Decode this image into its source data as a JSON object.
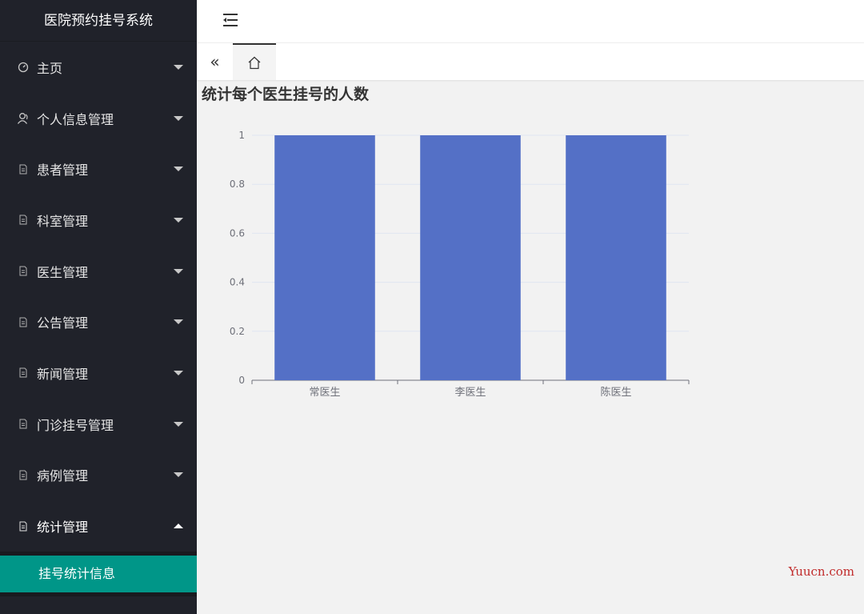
{
  "sidebar": {
    "title": "医院预约挂号系统",
    "items": [
      {
        "label": "主页",
        "icon": "dashboard-icon"
      },
      {
        "label": "个人信息管理",
        "icon": "user-icon"
      },
      {
        "label": "患者管理",
        "icon": "file-icon"
      },
      {
        "label": "科室管理",
        "icon": "file-icon"
      },
      {
        "label": "医生管理",
        "icon": "file-icon"
      },
      {
        "label": "公告管理",
        "icon": "file-icon"
      },
      {
        "label": "新闻管理",
        "icon": "file-icon"
      },
      {
        "label": "门诊挂号管理",
        "icon": "file-icon"
      },
      {
        "label": "病例管理",
        "icon": "file-icon"
      },
      {
        "label": "统计管理",
        "icon": "file-icon",
        "expanded": true
      }
    ],
    "submenu": [
      {
        "label": "挂号统计信息",
        "active": true
      }
    ]
  },
  "colors": {
    "sidebar_bg": "#20222a",
    "active_bg": "#009688",
    "bar_color": "#5470c6"
  },
  "content": {
    "title": "统计每个医生挂号的人数"
  },
  "watermark": "Yuucn.com",
  "chart_data": {
    "type": "bar",
    "title": "统计每个医生挂号的人数",
    "categories": [
      "常医生",
      "李医生",
      "陈医生"
    ],
    "values": [
      1,
      1,
      1
    ],
    "xlabel": "",
    "ylabel": "",
    "ylim": [
      0,
      1
    ],
    "yticks": [
      "0",
      "0.2",
      "0.4",
      "0.6",
      "0.8",
      "1"
    ],
    "grid": true
  }
}
